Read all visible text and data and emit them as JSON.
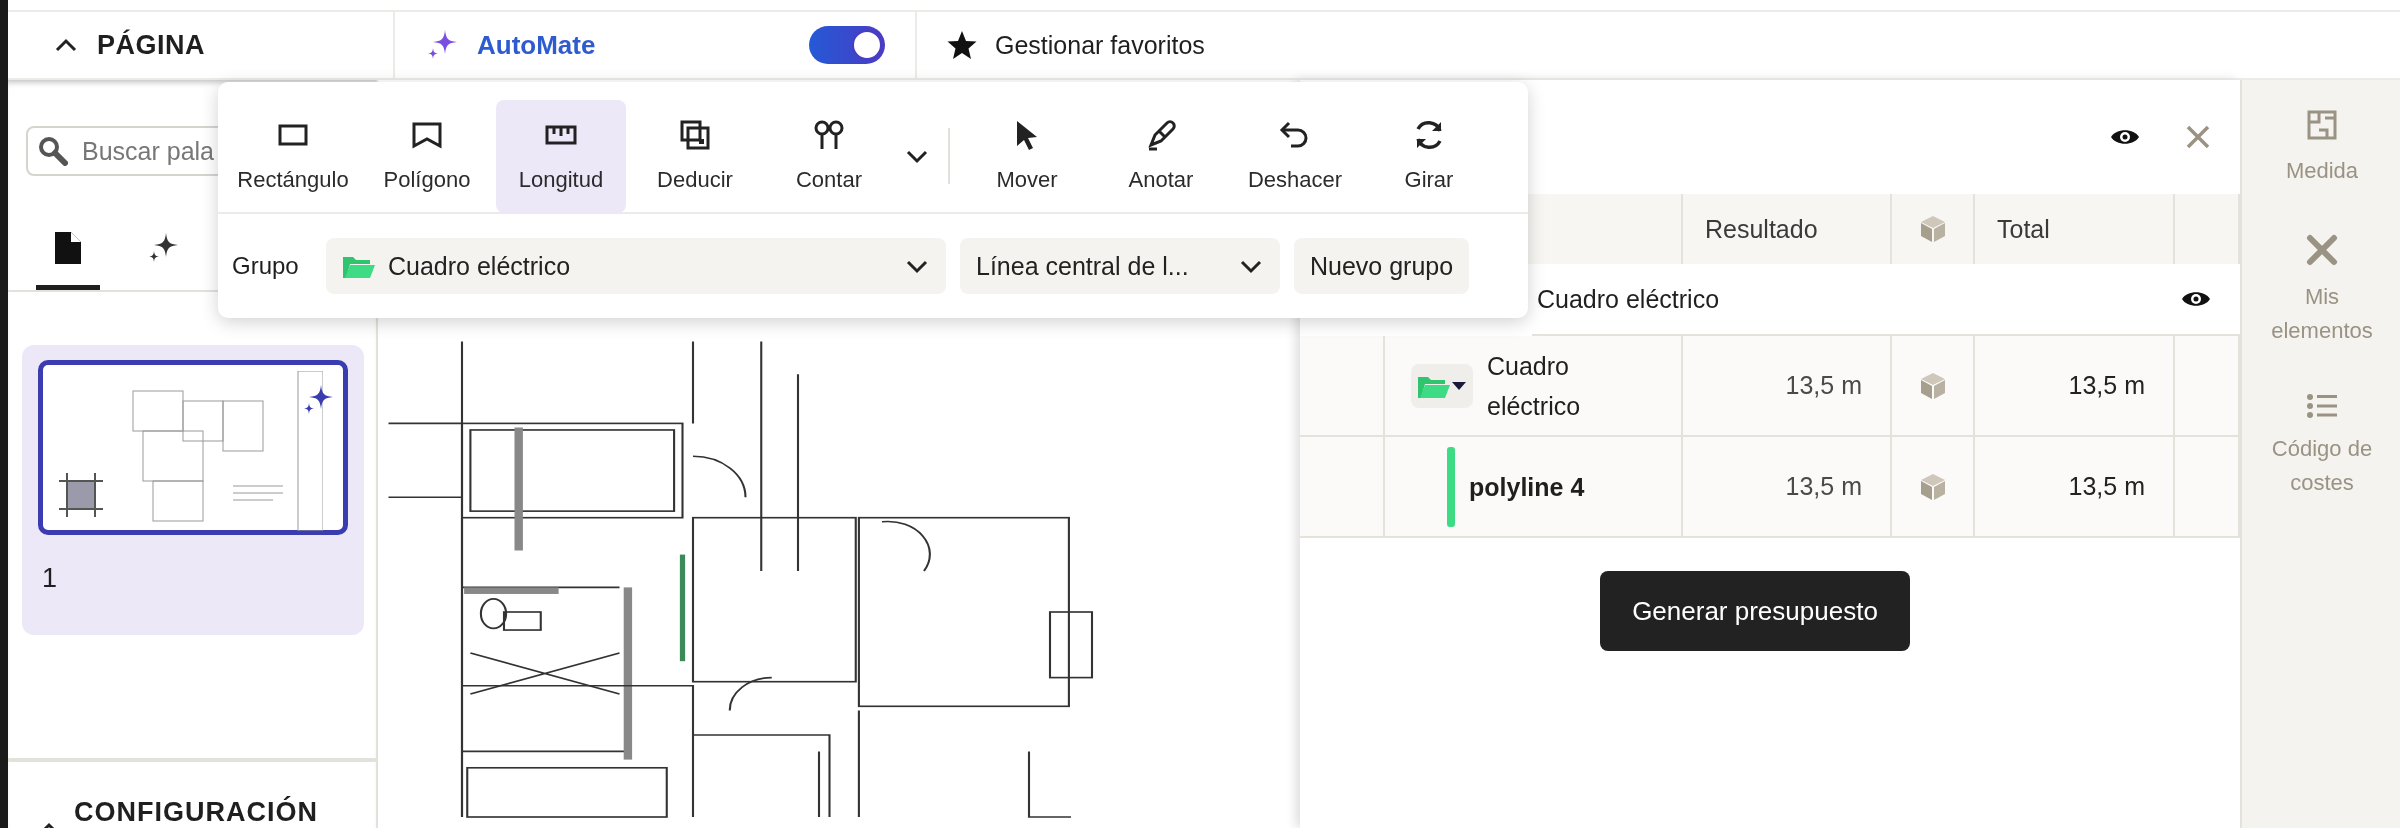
{
  "header": {
    "page_section": {
      "label": "PÁGINA",
      "expanded": true
    },
    "automate": {
      "label": "AutoMate",
      "on": true
    },
    "favorites": {
      "label": "Gestionar favoritos"
    }
  },
  "sidebar": {
    "search": {
      "placeholder": "Buscar pala"
    },
    "tabs": [
      {
        "kind": "document",
        "selected": true
      },
      {
        "kind": "sparkle",
        "selected": false
      }
    ],
    "pages": [
      {
        "label": "1",
        "selected": true
      }
    ],
    "config": {
      "label": "CONFIGURACIÓN"
    }
  },
  "toolbar": {
    "tools": [
      {
        "kind": "rectangle",
        "label": "Rectángulo",
        "selected": false
      },
      {
        "kind": "polygon",
        "label": "Polígono",
        "selected": false
      },
      {
        "kind": "length",
        "label": "Longitud",
        "selected": true
      },
      {
        "kind": "deduct",
        "label": "Deducir",
        "selected": false
      },
      {
        "kind": "count",
        "label": "Contar",
        "selected": false
      }
    ],
    "actions": [
      {
        "kind": "move",
        "label": "Mover"
      },
      {
        "kind": "annotate",
        "label": "Anotar"
      },
      {
        "kind": "undo",
        "label": "Deshacer"
      },
      {
        "kind": "rotate",
        "label": "Girar"
      }
    ],
    "group_label": "Grupo",
    "group_select": "Cuadro eléctrico",
    "mode_select": "Línea central de l...",
    "new_group": "Nuevo grupo"
  },
  "panel": {
    "columns": [
      "Resultado",
      "Total"
    ],
    "group": {
      "name": "Cuadro eléctrico"
    },
    "rows": [
      {
        "kind": "folder",
        "name": "Cuadro eléctrico",
        "result": "13,5 m",
        "total": "13,5 m"
      },
      {
        "kind": "item",
        "name": "polyline 4",
        "color": "#3ddc84",
        "result": "13,5 m",
        "total": "13,5 m"
      }
    ],
    "button": "Generar presupuesto"
  },
  "rail": [
    {
      "kind": "plan",
      "label": "Medida"
    },
    {
      "kind": "tools",
      "label": "Mis elementos"
    },
    {
      "kind": "list",
      "label": "Código de costes"
    }
  ]
}
